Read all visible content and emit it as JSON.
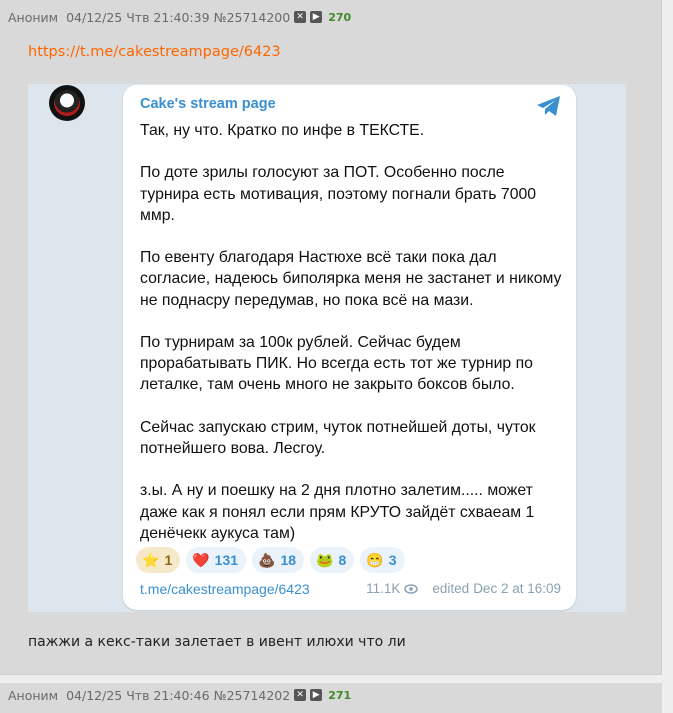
{
  "post": {
    "author": "Аноним",
    "date": "04/12/25 Чтв 21:40:39",
    "number": "№25714200",
    "hide_icon": "x-box-icon",
    "play_icon": "play-box-icon",
    "replies": "270",
    "link": "https://t.me/cakestreampage/6423",
    "comment": "пажжи а кекс-таки залетает в ивент илюхи что ли"
  },
  "embed": {
    "channel": "Cake's stream page",
    "paragraphs": [
      "Так, ну что. Кратко по инфе в ТЕКСТЕ.",
      "По доте зрилы голосуют за ПОТ. Особенно после турнира есть мотивация, поэтому погнали брать 7000 ммр.",
      "По евенту благодаря Настюхе всё таки пока дал согласие, надеюсь биполярка меня не застанет и никому не поднасру передумав, но пока всё на мази.",
      "По турнирам за 100к рублей. Сейчас будем прорабатывать ПИК. Но всегда есть тот же турнир по леталке, там очень много не закрыто боксов было.",
      "Сейчас запускаю стрим, чуток потнейшей доты, чуток потнейшего вова. Лесгоу.",
      "з.ы. А ну и поешку на 2 дня плотно залетим..... может даже как я понял если прям КРУТО зайдёт схваеам 1 денёчекк аукуса там)"
    ],
    "reactions": [
      {
        "emoji": "⭐",
        "count": "1",
        "icon": "star-icon"
      },
      {
        "emoji": "❤️",
        "count": "131",
        "icon": "heart-icon"
      },
      {
        "emoji": "💩",
        "count": "18",
        "icon": "poop-icon"
      },
      {
        "emoji": "🐸",
        "count": "8",
        "icon": "frog-icon"
      },
      {
        "emoji": "😁",
        "count": "3",
        "icon": "grin-icon"
      }
    ],
    "footer_link": "t.me/cakestreampage/6423",
    "views": "11.1K",
    "edited": "edited",
    "time": "Dec 2 at 16:09",
    "accent": "#3a8fd0"
  },
  "next_post": {
    "author": "Аноним",
    "date": "04/12/25 Чтв 21:40:46",
    "number": "№25714202",
    "replies": "271"
  }
}
